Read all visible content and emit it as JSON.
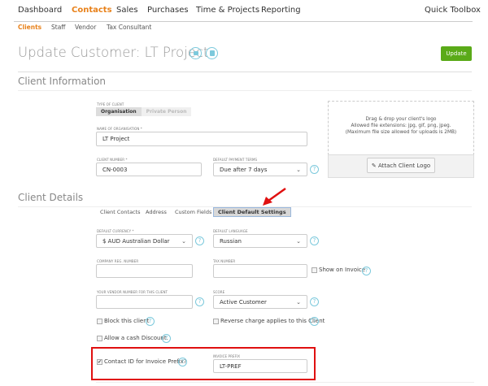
{
  "nav": {
    "items": [
      "Dashboard",
      "Contacts",
      "Sales",
      "Purchases",
      "Time & Projects",
      "Reporting"
    ],
    "active": "Contacts",
    "quick_toolbox": "Quick Toolbox"
  },
  "subnav": {
    "items": [
      "Clients",
      "Staff",
      "Vendor",
      "Tax Consultant"
    ],
    "active": "Clients"
  },
  "header": {
    "title": "Update Customer: LT Project",
    "update_label": "Update",
    "icons": [
      "video-icon",
      "book-icon"
    ]
  },
  "client_info": {
    "title": "Client Information",
    "type_label": "Type of client",
    "type_options": [
      "Organisation",
      "Private Person"
    ],
    "type_selected": "Organisation",
    "name_label": "Name of organisation *",
    "name_value": "LT Project",
    "number_label": "Client number *",
    "number_value": "CN-0003",
    "terms_label": "Default payment terms",
    "terms_value": "Due after 7 days",
    "logo": {
      "line1": "Drag & drop your client's logo",
      "line2": "Allowed file extensions: jpg, gif, png, jpeg.",
      "line3": "(Maximum file size allowed for uploads is 2MB)",
      "button": "Attach Client Logo"
    }
  },
  "client_details": {
    "title": "Client Details",
    "tabs": [
      "Client Contacts",
      "Address",
      "Custom Fields",
      "Client Default Settings"
    ],
    "active_tab": "Client Default Settings",
    "currency_label": "Default currency *",
    "currency_value": "$ AUD Australian Dollar",
    "language_label": "Default language",
    "language_value": "Russian",
    "reg_label": "Company reg. number",
    "reg_value": "",
    "tax_label": "Tax number",
    "tax_value": "",
    "show_invoice": "Show on Invoice",
    "vendor_label": "Your vendor number for this client",
    "vendor_value": "",
    "score_label": "Score",
    "score_value": "Active Customer",
    "block": "Block this client",
    "reverse": "Reverse charge applies to this Client",
    "cash": "Allow a cash Discount.",
    "contact_id": "Contact ID for Invoice Prefix?",
    "contact_id_checked": true,
    "prefix_label": "Invoice prefix",
    "prefix_value": "LT-PREF"
  },
  "colors": {
    "accent": "#e8811a",
    "update": "#5aaa18",
    "highlight": "#e01010",
    "help": "#7cc9dc"
  }
}
